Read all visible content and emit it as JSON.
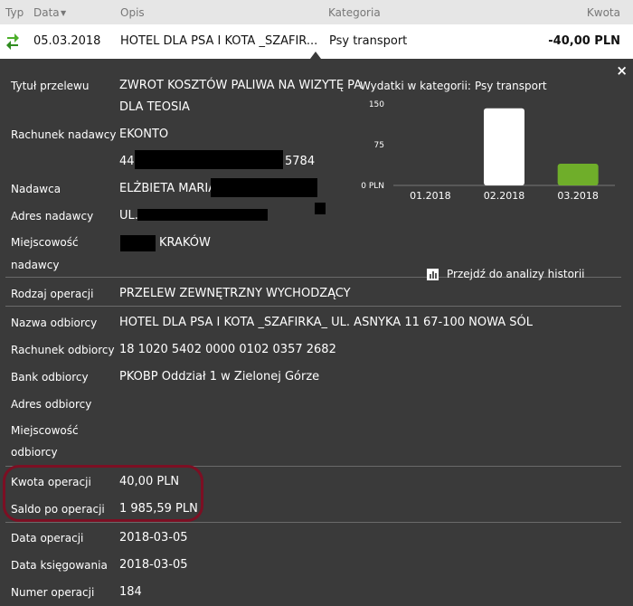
{
  "header": {
    "col_type": "Typ",
    "col_date": "Data",
    "sort_arrow": "▼",
    "col_desc": "Opis",
    "col_category": "Kategoria",
    "col_amount": "Kwota"
  },
  "transaction": {
    "icon": "transfer-arrows-icon",
    "date": "05.03.2018",
    "description": "HOTEL DLA PSA I KOTA _SZAFIR...",
    "category": "Psy transport",
    "amount": "-40,00 PLN"
  },
  "details": {
    "close": "×",
    "title_label": "Tytuł przelewu",
    "title_value_1": "ZWROT KOSZTÓW PALIWA NA WIZYTĘ PA",
    "title_value_2": "DLA TEOSIA",
    "sender_account_label": "Rachunek nadawcy",
    "sender_account_value_1": "EKONTO",
    "sender_account_prefix": "44",
    "sender_account_suffix": "5784",
    "sender_label": "Nadawca",
    "sender_value": "ELŻBIETA MARIA",
    "sender_address_label": "Adres nadawcy",
    "sender_address_value": "UL.",
    "sender_city_label_1": "Miejscowość",
    "sender_city_label_2": "nadawcy",
    "sender_city_value": "KRAKÓW",
    "op_type_label": "Rodzaj operacji",
    "op_type_value": "PRZELEW ZEWNĘTRZNY WYCHODZĄCY",
    "recipient_name_label": "Nazwa odbiorcy",
    "recipient_name_value": "HOTEL DLA PSA I KOTA _SZAFIRKA_ UL. ASNYKA 11 67-100 NOWA SÓL",
    "recipient_account_label": "Rachunek odbiorcy",
    "recipient_account_value": "18 1020 5402 0000 0102 0357 2682",
    "recipient_bank_label": "Bank odbiorcy",
    "recipient_bank_value": "PKOBP Oddział 1 w Zielonej Górze",
    "recipient_address_label": "Adres odbiorcy",
    "recipient_city_label_1": "Miejscowość",
    "recipient_city_label_2": "odbiorcy",
    "amount_label": "Kwota operacji",
    "amount_value": "40,00 PLN",
    "balance_label": "Saldo po operacji",
    "balance_value": "1 985,59 PLN",
    "op_date_label": "Data operacji",
    "op_date_value": "2018-03-05",
    "book_date_label": "Data księgowania",
    "book_date_value": "2018-03-05",
    "op_number_label": "Numer operacji",
    "op_number_value": "184"
  },
  "chart": {
    "title_prefix": "Wydatki w kategorii:",
    "title_category": "Psy transport",
    "link_label": "Przejdź do analizy historii",
    "link_icon": "bar-chart-icon"
  },
  "chart_data": {
    "type": "bar",
    "categories": [
      "01.2018",
      "02.2018",
      "03.2018"
    ],
    "values": [
      0,
      142,
      40
    ],
    "colors": [
      "#ffffff",
      "#ffffff",
      "#6fae2a"
    ],
    "yticks": [
      "0 PLN",
      "75",
      "150"
    ],
    "ylim": [
      0,
      150
    ],
    "title": "Wydatki w kategorii:  Psy transport"
  },
  "colors": {
    "highlight_ring": "#7c0f23",
    "panel_bg": "#3a3a3a",
    "accent_green": "#6fae2a"
  }
}
